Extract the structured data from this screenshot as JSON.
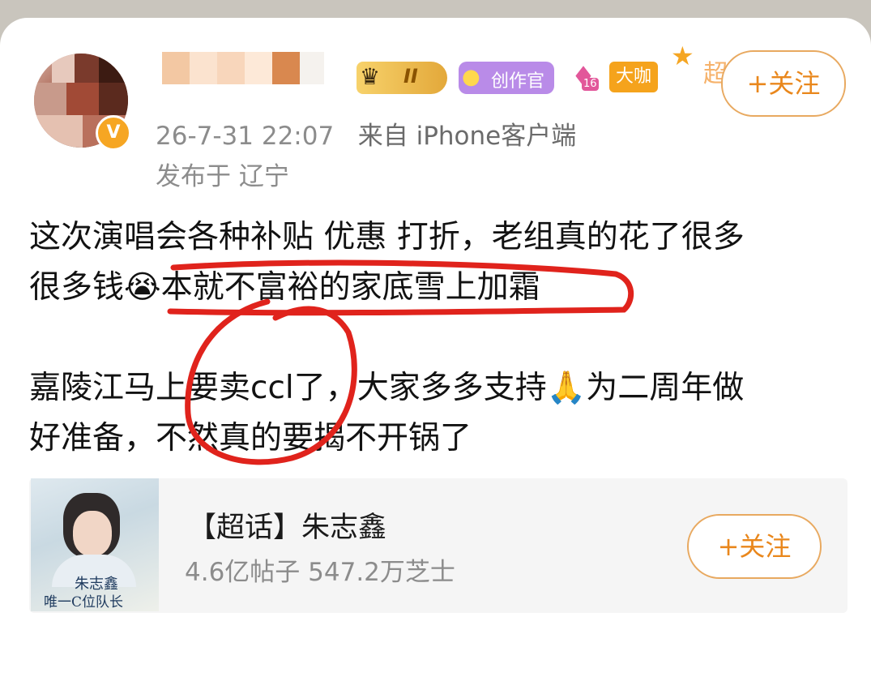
{
  "user": {
    "avatar_icon": "blurred-avatar",
    "verified_icon": "verified-badge-icon",
    "badges": {
      "crown_icon": "crown-icon",
      "level": "II",
      "creator_icon": "creator-chick-icon",
      "creator_label": "创作官",
      "diamond_icon": "diamond-icon",
      "diamond_level": "16",
      "coffee_label": "大咖",
      "super_icon": "super-topic-star-icon",
      "super_label": "超"
    },
    "follow_label": "+关注"
  },
  "meta": {
    "datetime": "26-7-31 22:07",
    "source": "来自 iPhone客户端",
    "location": "发布于 辽宁"
  },
  "post": {
    "p1_line1": "这次演唱会各种补贴 优惠 打折，老组真的花了很多",
    "p1_line2_a": "很多钱",
    "p1_line2_b": "本就不富裕的家底雪上加霜",
    "crying_emoji": "😭",
    "p2_line1_a": "嘉陵江马上要卖ccl了，大家多多支持",
    "praying_emoji": "🙏",
    "p2_line1_b": "为二周年做",
    "p2_line2": "好准备，不然真的要揭不开锅了"
  },
  "topic": {
    "cover_name": "朱志鑫",
    "cover_slogan": "唯一C位队长",
    "title": "【超话】朱志鑫",
    "stats": "4.6亿帖子 547.2万芝士",
    "follow_label": "+关注"
  },
  "colors": {
    "accent": "#e9871c",
    "annotation": "#e0231c"
  }
}
